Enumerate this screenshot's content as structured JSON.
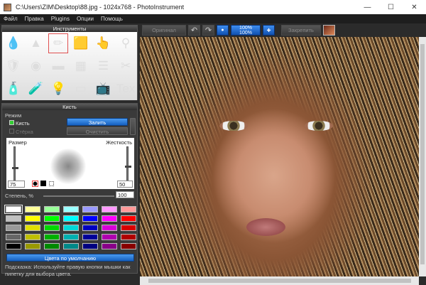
{
  "window": {
    "title": "C:\\Users\\ZIM\\Desktop\\88.jpg - 1024x768 - PhotoInstrument",
    "minimize": "—",
    "maximize": "☐",
    "close": "✕"
  },
  "menu": [
    "Файл",
    "Правка",
    "Plugins",
    "Опции",
    "Помощь"
  ],
  "tools_panel": {
    "title": "Инструменты",
    "tools": [
      {
        "icon": "droplet-icon",
        "glyph": "💧"
      },
      {
        "icon": "cone-icon",
        "glyph": "▲"
      },
      {
        "icon": "pencil-brush-icon",
        "glyph": "✏",
        "selected": true
      },
      {
        "icon": "stamp-icon",
        "glyph": "🟨"
      },
      {
        "icon": "finger-icon",
        "glyph": "👆"
      },
      {
        "icon": "pin-icon",
        "glyph": "⚲"
      },
      {
        "icon": "shield-icon",
        "glyph": "🛡"
      },
      {
        "icon": "red-eye-icon",
        "glyph": "◉"
      },
      {
        "icon": "gradient-icon",
        "glyph": "▬"
      },
      {
        "icon": "color-bars-icon",
        "glyph": "▦"
      },
      {
        "icon": "lines-icon",
        "glyph": "☰"
      },
      {
        "icon": "clone-scissors-icon",
        "glyph": "✂"
      },
      {
        "icon": "tube-icon",
        "glyph": "🧴"
      },
      {
        "icon": "bottle-icon",
        "glyph": "🧪"
      },
      {
        "icon": "bulb-icon",
        "glyph": "💡"
      },
      {
        "icon": "eraser-icon",
        "glyph": "▭"
      },
      {
        "icon": "tv-icon",
        "glyph": "📺"
      },
      {
        "icon": "text-layers-icon",
        "glyph": "Tex"
      }
    ]
  },
  "brush_panel": {
    "title": "Кисть",
    "mode_label": "Режим",
    "brush_option": "Кисть",
    "eraser_option": "Стёрка",
    "fill_button": "Залить",
    "clear_button": "Очистить",
    "size_label": "Размер",
    "hardness_label": "Жесткость",
    "size_value": "75",
    "hardness_value": "50",
    "size_level": 0.75,
    "hardness_level": 0.5,
    "degree_label": "Степень, %",
    "degree_value": "100",
    "palette": [
      [
        "#ffffff",
        "#ffff99",
        "#99ff99",
        "#99ffff",
        "#9999ff",
        "#ff99ff",
        "#ff9999"
      ],
      [
        "#c0c0c0",
        "#ffff00",
        "#00ff00",
        "#00ffff",
        "#0000ff",
        "#ff00ff",
        "#ff0000"
      ],
      [
        "#999999",
        "#e0e000",
        "#00d800",
        "#00d8d8",
        "#0000c0",
        "#d800d8",
        "#d80000"
      ],
      [
        "#666666",
        "#c0c000",
        "#00b000",
        "#00b0b0",
        "#000099",
        "#b000b0",
        "#b00000"
      ],
      [
        "#000000",
        "#999900",
        "#008800",
        "#008888",
        "#000080",
        "#880088",
        "#880000"
      ]
    ],
    "default_colors_button": "Цвета по умолчанию",
    "hint": "Подсказка: Используйте правую кнопки мышки как пипетку для выбора цвета."
  },
  "toolbar": {
    "original": "Оригинал",
    "zoom_top": "100%",
    "zoom_bottom": "100%",
    "pin": "Закрепить"
  }
}
